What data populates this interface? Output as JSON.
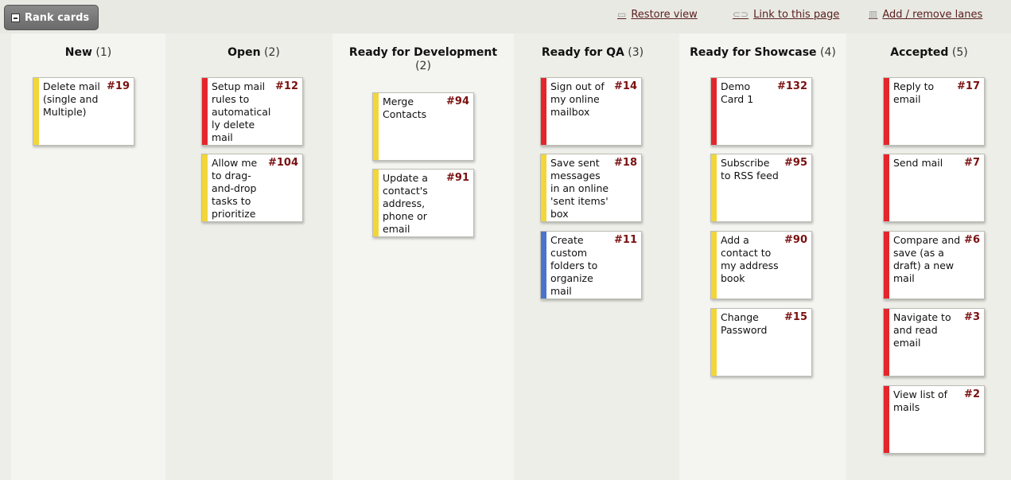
{
  "toolbar": {
    "rank_cards_label": "Rank cards",
    "restore_view_label": "Restore view",
    "link_page_label": "Link to this page",
    "add_remove_lanes_label": "Add / remove lanes"
  },
  "colors": {
    "yellow": "#f2d63a",
    "red": "#e2262b",
    "blue": "#4a74c9"
  },
  "columns": [
    {
      "name": "New",
      "count": "(1)",
      "cards": [
        {
          "number": "#19",
          "title": "Delete mail (single and Multiple)",
          "color": "#f2d63a"
        }
      ]
    },
    {
      "name": "Open",
      "count": "(2)",
      "cards": [
        {
          "number": "#12",
          "title": "Setup mail rules to automatically delete mail",
          "color": "#e2262b"
        },
        {
          "number": "#104",
          "title": "Allow me to drag-and-drop tasks to prioritize them",
          "color": "#f2d63a"
        }
      ]
    },
    {
      "name": "Ready for Development",
      "count": "(2)",
      "cards": [
        {
          "number": "#94",
          "title": "Merge Contacts",
          "color": "#f2d63a"
        },
        {
          "number": "#91",
          "title": "Update a contact's address, phone or email",
          "color": "#f2d63a"
        }
      ]
    },
    {
      "name": "Ready for QA",
      "count": "(3)",
      "cards": [
        {
          "number": "#14",
          "title": "Sign out of my online mailbox",
          "color": "#e2262b"
        },
        {
          "number": "#18",
          "title": "Save sent messages in an online 'sent items' box",
          "color": "#f2d63a"
        },
        {
          "number": "#11",
          "title": "Create custom folders to organize mail",
          "color": "#4a74c9"
        }
      ]
    },
    {
      "name": "Ready for Showcase",
      "count": "(4)",
      "cards": [
        {
          "number": "#132",
          "title": "Demo Card 1",
          "color": "#e2262b"
        },
        {
          "number": "#95",
          "title": "Subscribe to RSS feed",
          "color": "#f2d63a"
        },
        {
          "number": "#90",
          "title": "Add a contact to my address book",
          "color": "#f2d63a"
        },
        {
          "number": "#15",
          "title": "Change Password",
          "color": "#f2d63a"
        }
      ]
    },
    {
      "name": "Accepted",
      "count": "(5)",
      "cards": [
        {
          "number": "#17",
          "title": "Reply to email",
          "color": "#e2262b"
        },
        {
          "number": "#7",
          "title": "Send mail",
          "color": "#e2262b"
        },
        {
          "number": "#6",
          "title": "Compare and save (as a draft) a new mail",
          "color": "#e2262b"
        },
        {
          "number": "#3",
          "title": "Navigate to and read email",
          "color": "#e2262b"
        },
        {
          "number": "#2",
          "title": "View list of mails",
          "color": "#e2262b"
        }
      ]
    }
  ]
}
